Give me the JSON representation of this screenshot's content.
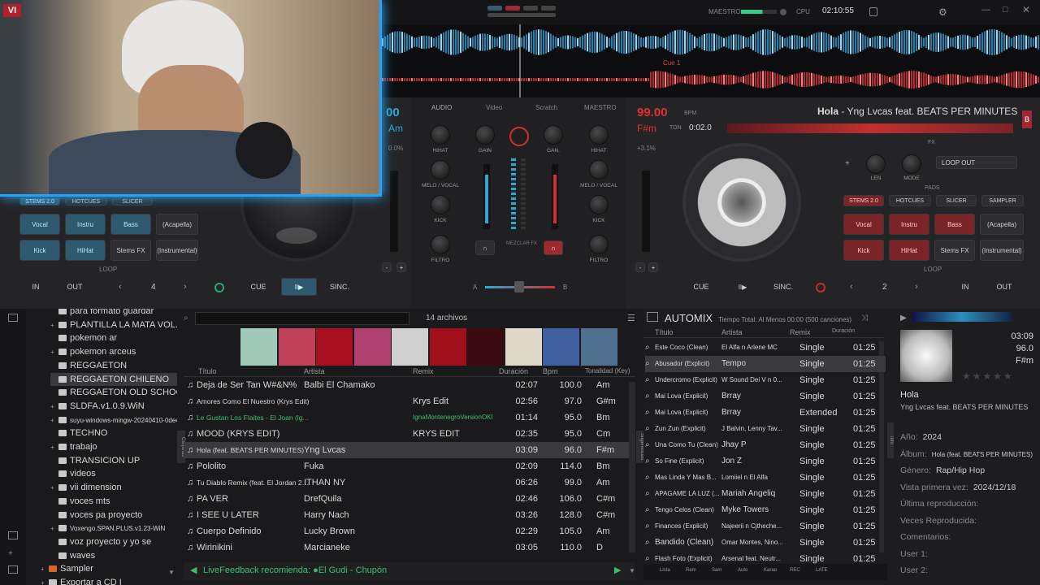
{
  "topbar": {
    "master_label": "MAESTRO",
    "cpu_label": "CPU",
    "clock": "02:10:55"
  },
  "webcam": {
    "logo_partial": "VI"
  },
  "waveform": {
    "cue_label": "Cue 1"
  },
  "deck_left": {
    "bpm_partial": "00",
    "key_partial": "Am",
    "pitch_partial": "0.0%",
    "pad_tabs": [
      "STEMS 2.0",
      "HOTCUES",
      "SLICER"
    ],
    "pads_row1": [
      "Vocal",
      "Instru",
      "Bass",
      "(Acapella)"
    ],
    "pads_row2": [
      "Kick",
      "HiHat",
      "Stems FX",
      "(Instrumental)"
    ],
    "loop_label": "LOOP",
    "loop_size": "4",
    "in_label": "IN",
    "out_label": "OUT",
    "cue_label": "CUE",
    "play_label": "II▶",
    "sync_label": "SINC."
  },
  "mixer": {
    "tabs": [
      "AUDIO",
      "Video",
      "Scratch",
      "MAESTRO"
    ],
    "left_labels": [
      "HIHAT",
      "MELO / VOCAL",
      "KICK",
      "FILTRO"
    ],
    "right_labels": [
      "HIHAT",
      "MELO / VOCAL",
      "KICK",
      "FILTRO"
    ],
    "gain_labels": [
      "GAIN",
      "GAN."
    ],
    "mic_label": "MEZCLAR FX",
    "cross_a": "A",
    "cross_b": "B"
  },
  "deck_right": {
    "bpm": "99.00",
    "bpm_unit": "BPM",
    "key": "F#m",
    "ton": "TON",
    "time": "0:02.0",
    "title": "Hola",
    "artist": "Yng Lvcas feat. BEATS PER MINUTES",
    "title_sep": " - ",
    "deck_letter": "B",
    "pitch": "+3.1%",
    "fx_label": "FX",
    "len_label": "LEN",
    "mode_label": "MODE",
    "loop_out_select": "LOOP OUT",
    "pads_label": "PADS",
    "pad_tabs": [
      "STEMS 2.0",
      "HOTCUES",
      "SLICER",
      "SAMPLER"
    ],
    "pads_row1": [
      "Vocal",
      "Instru",
      "Bass",
      "(Acapella)"
    ],
    "pads_row2": [
      "Kick",
      "HiHat",
      "Stems FX",
      "(Instrumental)"
    ],
    "loop_label": "LOOP",
    "loop_size": "2",
    "in_label": "IN",
    "out_label": "OUT",
    "cue_label": "CUE",
    "play_label": "II▶",
    "sync_label": "SINC."
  },
  "folders": [
    {
      "label": "para formato guardar",
      "expanded": false
    },
    {
      "label": "PLANTILLA LA MATA VOL.1",
      "expanded": true
    },
    {
      "label": "pokemon ar",
      "expanded": false
    },
    {
      "label": "pokemon arceus",
      "expanded": true
    },
    {
      "label": "REGGAETON",
      "expanded": false
    },
    {
      "label": "REGGAETON CHILENO",
      "expanded": false
    },
    {
      "label": "REGGAETON OLD SCHOOL",
      "expanded": false
    },
    {
      "label": "SLDFA.v1.0.9.WiN",
      "expanded": true
    },
    {
      "label": "suyu-windows-mingw-20240410-0de4",
      "expanded": true
    },
    {
      "label": "TECHNO",
      "expanded": false
    },
    {
      "label": "trabajo",
      "expanded": true
    },
    {
      "label": "TRANSICION UP",
      "expanded": false
    },
    {
      "label": "videos",
      "expanded": false
    },
    {
      "label": "vii dimension",
      "expanded": true
    },
    {
      "label": "voces mts",
      "expanded": false
    },
    {
      "label": "voces pa proyecto",
      "expanded": false
    },
    {
      "label": "Voxengo.SPAN.PLUS.v1.23-WiN",
      "expanded": true
    },
    {
      "label": "voz proyecto y yo se",
      "expanded": false
    },
    {
      "label": "waves",
      "expanded": false
    },
    {
      "label": "Sampler",
      "expanded": true
    },
    {
      "label": "Exportar a CD I",
      "expanded": true
    }
  ],
  "side_tabs": {
    "left": "Carpetas",
    "middle": "Sugerencias",
    "right": "Info"
  },
  "tracklist": {
    "count": "14 archivos",
    "headers": {
      "title": "Título",
      "artist": "Artista",
      "remix": "Remix",
      "duration": "Duración",
      "bpm": "Bpm",
      "key": "Tonalidad (Key)"
    },
    "rows": [
      {
        "title": "Deja de Ser Tan W#&N%",
        "artist": "Balbi El Chamako",
        "remix": "",
        "duration": "02:07",
        "bpm": "100.0",
        "key": "Am",
        "small": false
      },
      {
        "title": "Amores Como El Nuestro (Krys Edit)",
        "artist": "",
        "remix": "Krys Edit",
        "duration": "02:56",
        "bpm": "97.0",
        "key": "G#m",
        "small": true
      },
      {
        "title": "Le Gustan Los Flaites - El Joan (lg...",
        "artist": "",
        "remix": "IgnaMontenegroVersionOKI",
        "duration": "01:14",
        "bpm": "95.0",
        "key": "Bm",
        "small": true
      },
      {
        "title": "MOOD (KRYS EDIT)",
        "artist": "",
        "remix": "KRYS EDIT",
        "duration": "02:35",
        "bpm": "95.0",
        "key": "Cm",
        "small": false
      },
      {
        "title": "Hola (feat. BEATS PER MINUTES)",
        "artist": "Yng Lvcas",
        "remix": "",
        "duration": "03:09",
        "bpm": "96.0",
        "key": "F#m",
        "small": true
      },
      {
        "title": "Pololito",
        "artist": "Fuka",
        "remix": "",
        "duration": "02:09",
        "bpm": "114.0",
        "key": "Bm",
        "small": false
      },
      {
        "title": "Tu Diablo Remix (feat. El Jordan 23...",
        "artist": "ITHAN NY",
        "remix": "",
        "duration": "06:26",
        "bpm": "99.0",
        "key": "Am",
        "small": true
      },
      {
        "title": "PA VER",
        "artist": "DrefQuila",
        "remix": "",
        "duration": "02:46",
        "bpm": "106.0",
        "key": "C#m",
        "small": false
      },
      {
        "title": "I SEE U LATER",
        "artist": "Harry Nach",
        "remix": "",
        "duration": "03:26",
        "bpm": "128.0",
        "key": "C#m",
        "small": false
      },
      {
        "title": "Cuerpo Definido",
        "artist": "Lucky Brown",
        "remix": "",
        "duration": "02:29",
        "bpm": "105.0",
        "key": "Am",
        "small": false
      },
      {
        "title": "Wirinikini",
        "artist": "Marcianeke",
        "remix": "",
        "duration": "03:05",
        "bpm": "110.0",
        "key": "D",
        "small": false
      }
    ],
    "live_feedback": "LiveFeedback recomienda: ●El Gudi - Chupón"
  },
  "automix": {
    "title": "AUTOMIX",
    "total_time": "Tiempo Total: Al Menos 00:00 (500 canciones)",
    "headers": {
      "title": "Título",
      "artist": "Artista",
      "remix": "Remix",
      "duration": "Duración"
    },
    "rows": [
      {
        "title": "Este Coco (Clean)",
        "artist": "El Alfa n Arlene MC",
        "remix": "Single",
        "duration": "01:25"
      },
      {
        "title": "Abusador (Explicit)",
        "artist": "Tempo",
        "remix": "Single",
        "duration": "01:25"
      },
      {
        "title": "Undercromo (Explicit)",
        "artist": "W Sound Dei V n 0...",
        "remix": "Single",
        "duration": "01:25"
      },
      {
        "title": "Mai Lova (Explicit)",
        "artist": "Brray",
        "remix": "Single",
        "duration": "01:25"
      },
      {
        "title": "Mai Lova (Explicit)",
        "artist": "Brray",
        "remix": "Extended",
        "duration": "01:25"
      },
      {
        "title": "Zun Zun (Explicit)",
        "artist": "J Balvin, Lenny Tav...",
        "remix": "Single",
        "duration": "01:25"
      },
      {
        "title": "Una Como Tu (Clean)",
        "artist": "Jhay P",
        "remix": "Single",
        "duration": "01:25"
      },
      {
        "title": "So Fine (Explicit)",
        "artist": "Jon Z",
        "remix": "Single",
        "duration": "01:25"
      },
      {
        "title": "Mas Linda Y Mas B...",
        "artist": "Lomiiel n El Alfa",
        "remix": "Single",
        "duration": "01:25"
      },
      {
        "title": "APAGAME LA LUZ (...",
        "artist": "Mariah Angeliq",
        "remix": "Single",
        "duration": "01:25"
      },
      {
        "title": "Tengo Celos (Clean)",
        "artist": "Myke Towers",
        "remix": "Single",
        "duration": "01:25"
      },
      {
        "title": "Finances (Explicit)",
        "artist": "Najeerii n Cjtheche...",
        "remix": "Single",
        "duration": "01:25"
      },
      {
        "title": "Bandido (Clean)",
        "artist": "Omar Montes, Nino...",
        "remix": "Single",
        "duration": "01:25"
      },
      {
        "title": "Flash Foto (Explicit)",
        "artist": "Arsenal feat. Neutr...",
        "remix": "Single",
        "duration": "01:25"
      }
    ],
    "footer": [
      "Lista",
      "Rem",
      "Sam",
      "Auto",
      "Karao",
      "REC",
      "LATE"
    ]
  },
  "info": {
    "duration": "03:09",
    "bpm": "96.0",
    "key": "F#m",
    "title": "Hola",
    "artist": "Yng Lvcas feat. BEATS PER MINUTES",
    "fields": [
      {
        "label": "Año:",
        "value": "2024"
      },
      {
        "label": "Álbum:",
        "value": "Hola (feat. BEATS PER MINUTES)"
      },
      {
        "label": "Género:",
        "value": "Rap/Hip Hop"
      },
      {
        "label": "Vista primera vez:",
        "value": "2024/12/18"
      },
      {
        "label": "Última reproducción:",
        "value": ""
      },
      {
        "label": "Veces Reproducida:",
        "value": ""
      },
      {
        "label": "Comentarios:",
        "value": ""
      },
      {
        "label": "User 1:",
        "value": ""
      },
      {
        "label": "User 2:",
        "value": ""
      }
    ]
  },
  "colors": {
    "deck_right_accent": "#e03030",
    "deck_left_accent": "#2aa9d8",
    "webcam_glow": "#21a4ff"
  }
}
